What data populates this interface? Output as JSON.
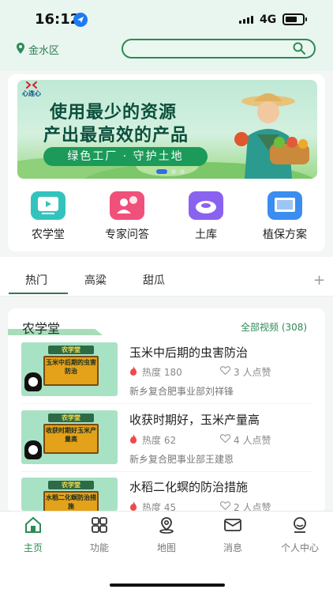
{
  "status_bar": {
    "time": "16:12",
    "network": "4G"
  },
  "header": {
    "location": "金水区",
    "search_placeholder": ""
  },
  "banner": {
    "logo_text": "心连心",
    "title_line1": "使用最少的资源",
    "title_line2": "产出最高效的产品",
    "slogan": "绿色工厂 · 守护土地"
  },
  "features": [
    {
      "label": "农学堂",
      "icon": "video-icon",
      "color": "#33c3bf"
    },
    {
      "label": "专家问答",
      "icon": "expert-icon",
      "color": "#f0507a"
    },
    {
      "label": "土库",
      "icon": "soil-icon",
      "color": "#8a62f0"
    },
    {
      "label": "植保方案",
      "icon": "plant-protection-icon",
      "color": "#3b8df0"
    }
  ],
  "tabs": [
    "热门",
    "高粱",
    "甜瓜"
  ],
  "tab_add": "+",
  "section": {
    "title": "农学堂",
    "more": "全部视频 (308)"
  },
  "items": [
    {
      "thumb_head": "农学堂",
      "thumb_text": "玉米中后期的虫害防治",
      "title": "玉米中后期的虫害防治",
      "heat": "热度 180",
      "likes": "3 人点赞",
      "org": "新乡复合肥事业部刘祥锋"
    },
    {
      "thumb_head": "农学堂",
      "thumb_text": "收获时期好玉米产量高",
      "title": "收获时期好，玉米产量高",
      "heat": "热度 62",
      "likes": "4 人点赞",
      "org": "新乡复合肥事业部王建恩"
    },
    {
      "thumb_head": "农学堂",
      "thumb_text": "水稻二化螟防治措施",
      "title": "水稻二化螟的防治措施",
      "heat": "热度 45",
      "likes": "2 人点赞",
      "org": ""
    }
  ],
  "tabbar": [
    {
      "label": "主页",
      "icon": "home-icon",
      "active": true
    },
    {
      "label": "功能",
      "icon": "grid-icon",
      "active": false
    },
    {
      "label": "地图",
      "icon": "map-icon",
      "active": false
    },
    {
      "label": "消息",
      "icon": "mail-icon",
      "active": false
    },
    {
      "label": "个人中心",
      "icon": "profile-icon",
      "active": false
    }
  ],
  "colors": {
    "brand": "#2d8a57",
    "banner_pill": "#1c9a5a"
  }
}
